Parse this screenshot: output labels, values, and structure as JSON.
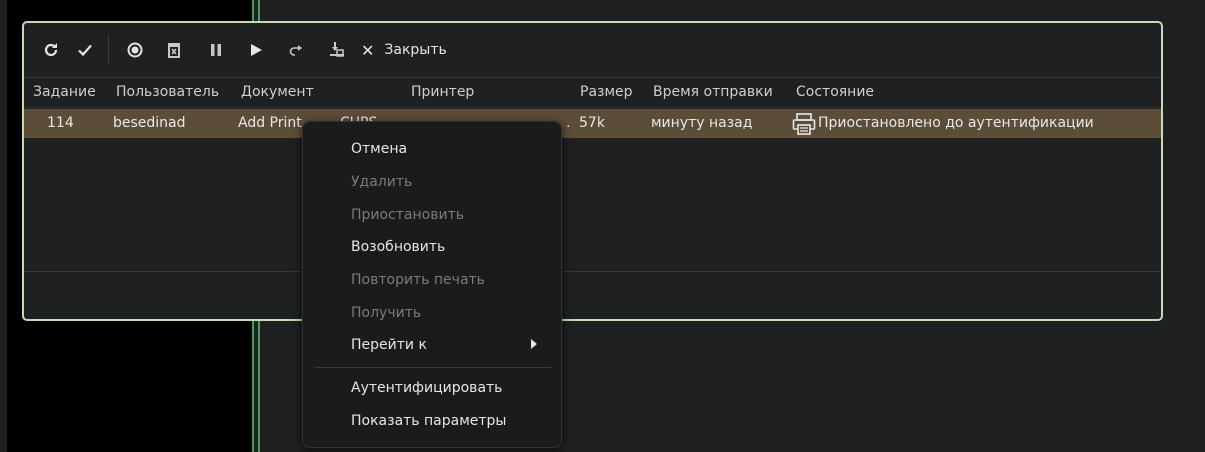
{
  "toolbar": {
    "close_label": "Закрыть",
    "icons": [
      "refresh-icon",
      "check-icon",
      "record-icon",
      "trash-icon",
      "pause-icon",
      "play-icon",
      "redo-icon",
      "move-to-printer-icon",
      "close-icon"
    ]
  },
  "table": {
    "headers": [
      "Задание",
      "Пользователь",
      "Документ",
      "Принтер",
      "Размер",
      "Время отправки",
      "Состояние"
    ],
    "rows": [
      {
        "job": "114",
        "user": "besedinad",
        "document": "Add Print",
        "printer": "CUPS",
        "printer_tail": ".",
        "size": "57k",
        "time": "минуту назад",
        "status": "Приостановлено до аутентификации"
      }
    ]
  },
  "menu": {
    "items": [
      {
        "label": "Отмена",
        "enabled": true
      },
      {
        "label": "Удалить",
        "enabled": false
      },
      {
        "label": "Приостановить",
        "enabled": false
      },
      {
        "label": "Возобновить",
        "enabled": true
      },
      {
        "label": "Повторить печать",
        "enabled": false
      },
      {
        "label": "Получить",
        "enabled": false
      },
      {
        "label": "Перейти к",
        "enabled": true,
        "submenu": true
      },
      {
        "label": "Аутентифицировать",
        "enabled": true
      },
      {
        "label": "Показать параметры",
        "enabled": true
      }
    ]
  },
  "colors": {
    "selected_row": "#5c4d39",
    "window_border": "#c3dcb4",
    "accent_line": "#4e9a5a"
  }
}
